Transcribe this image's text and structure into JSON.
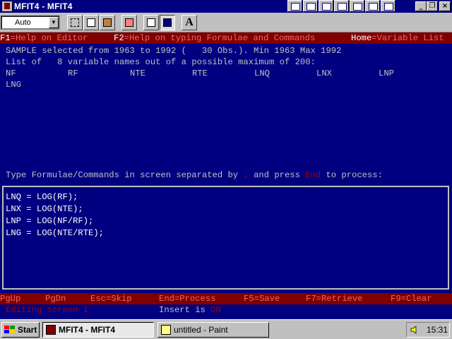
{
  "window": {
    "title": "MFIT4 - MFIT4",
    "minimize": "_",
    "maximize": "❐",
    "close": "×"
  },
  "toolbar": {
    "font_select_value": "Auto",
    "font_button_label": "A"
  },
  "fkeys": {
    "f1_key": "F1",
    "f1_text": "=Help on Editor",
    "f2_key": "F2",
    "f2_text": "=Help on typing Formulae and Commands",
    "home_key": "Home",
    "home_text": "=Variable List"
  },
  "info": {
    "sample_line": "SAMPLE selected from 1963 to 1992 (   30 Obs.). Min 1963 Max 1992",
    "list_line": "List of   8 variable names out of a possible maximum of 200:",
    "variables": [
      "NF",
      "RF",
      "NTE",
      "RTE",
      "LNQ",
      "LNX",
      "LNP",
      "LNG"
    ]
  },
  "prompt": {
    "before": "Type Formulae/Commands in screen separated by ",
    "sep": ";",
    "middle": " and press ",
    "key": "End",
    "after": " to process:"
  },
  "editor": {
    "lines": [
      "LNQ = LOG(RF);",
      "LNX = LOG(NTE);",
      "LNP = LOG(NF/RF);",
      "LNG = LOG(NTE/RTE);"
    ]
  },
  "bottom_keys": {
    "pgup": "PgUp",
    "pgdn": "PgDn",
    "esc": "Esc=Skip",
    "end": "End=Process",
    "f5": "F5=Save",
    "f7": "F7=Retrieve",
    "f9": "F9=Clear"
  },
  "status": {
    "editing": "Editing screen 1",
    "insert": "Insert is ",
    "insert_state": "ON"
  },
  "taskbar": {
    "start": "Start",
    "tasks": [
      "MFIT4 - MFIT4",
      "untitled - Paint"
    ],
    "clock": "15:31"
  },
  "colors": {
    "background": "#000080",
    "fkey_bar": "#800000",
    "fkey_text": "#ff6060",
    "normal_text": "#c0c0c0",
    "highlight_text": "#a00000"
  }
}
